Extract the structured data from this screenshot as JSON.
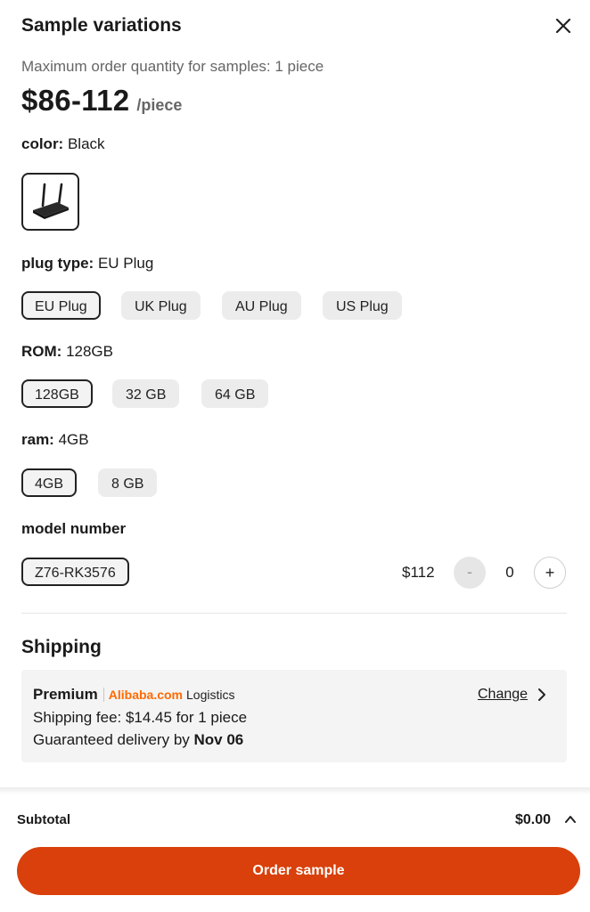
{
  "modal": {
    "title": "Sample variations",
    "subtitle": "Maximum order quantity for samples: 1 piece",
    "close_icon": "close-icon"
  },
  "price": {
    "range": "$86-112",
    "unit": "/piece"
  },
  "color": {
    "label": "color:",
    "value": "Black",
    "thumbnail": "router-thumbnail"
  },
  "plug_type": {
    "label": "plug type:",
    "value": "EU Plug",
    "options": [
      "EU Plug",
      "UK Plug",
      "AU Plug",
      "US Plug"
    ],
    "selected": "EU Plug"
  },
  "rom": {
    "label": "ROM:",
    "value": "128GB",
    "options": [
      "128GB",
      "32 GB",
      "64 GB"
    ],
    "selected": "128GB"
  },
  "ram": {
    "label": "ram:",
    "value": "4GB",
    "options": [
      "4GB",
      "8 GB"
    ],
    "selected": "4GB"
  },
  "model_number": {
    "label": "model number",
    "option": "Z76-RK3576",
    "price": "$112",
    "quantity": "0",
    "minus": "-",
    "plus": "+"
  },
  "shipping": {
    "title": "Shipping",
    "tier": "Premium",
    "brand": "Alibaba.com",
    "logistics": "Logistics",
    "fee_text": "Shipping fee: $14.45 for 1 piece",
    "delivery_prefix": "Guaranteed delivery by",
    "delivery_date": "Nov 06",
    "change_label": "Change"
  },
  "footer": {
    "subtotal_label": "Subtotal",
    "subtotal_value": "$0.00",
    "order_button": "Order sample"
  },
  "colors": {
    "accent": "#d9400b",
    "brand_orange": "#ff6a00",
    "chip_bg": "#ececec",
    "card_bg": "#f4f4f4"
  }
}
